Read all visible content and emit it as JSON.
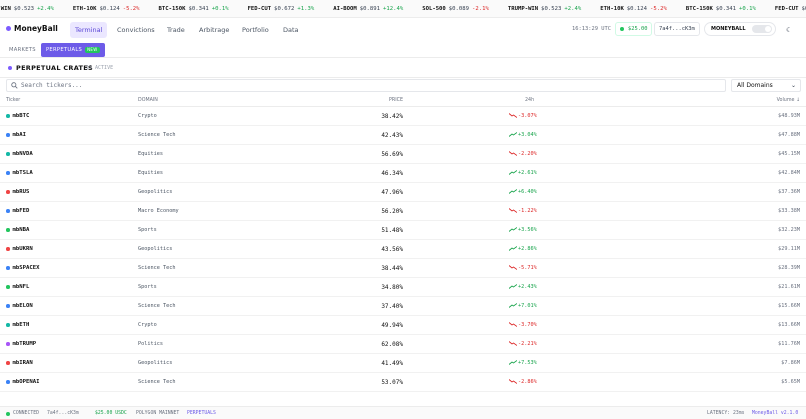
{
  "ticker_items": [
    {
      "sym": "P-WIN",
      "price": "$0.523",
      "chg": "+2.4%",
      "dir": "up"
    },
    {
      "sym": "ETH-10K",
      "price": "$0.124",
      "chg": "-5.2%",
      "dir": "down"
    },
    {
      "sym": "BTC-150K",
      "price": "$0.341",
      "chg": "+0.1%",
      "dir": "up"
    },
    {
      "sym": "FED-CUT",
      "price": "$0.672",
      "chg": "+1.3%",
      "dir": "up"
    },
    {
      "sym": "AI-BOOM",
      "price": "$0.891",
      "chg": "+12.4%",
      "dir": "up"
    },
    {
      "sym": "SOL-500",
      "price": "$0.089",
      "chg": "-2.1%",
      "dir": "down"
    },
    {
      "sym": "TRUMP-WIN",
      "price": "$0.523",
      "chg": "+2.4%",
      "dir": "up"
    },
    {
      "sym": "ETH-10K",
      "price": "$0.124",
      "chg": "-5.2%",
      "dir": "down"
    },
    {
      "sym": "BTC-150K",
      "price": "$0.341",
      "chg": "+0.1%",
      "dir": "up"
    },
    {
      "sym": "FED-CUT",
      "price": "$0.672",
      "chg": "+1.3%",
      "dir": "up"
    }
  ],
  "header": {
    "logo": "MoneyBall",
    "nav": [
      "Terminal",
      "Convictions",
      "Trade",
      "Arbitrage",
      "Portfolio",
      "Data"
    ],
    "clock": "16:13:29 UTC",
    "balance": "$25.00",
    "address": "7a4f...cK3m",
    "toggle_label": "MONEYBALL"
  },
  "subnav": {
    "markets": "MARKETS",
    "perpetuals": "PERPETUALS",
    "new_badge": "NEW"
  },
  "section": {
    "title": "PERPETUAL CRATES",
    "count": "15 ACTIVE"
  },
  "search": {
    "placeholder": "Search tickers...",
    "domain_filter": "All Domains"
  },
  "table": {
    "headers": {
      "ticker": "Ticker",
      "domain": "DOMAIN",
      "price": "PRICE",
      "change": "24h",
      "volume": "Volume ↓"
    },
    "rows": [
      {
        "ticker": "mbBTC",
        "domain": "Crypto",
        "price": "38.42%",
        "change": "-3.07%",
        "dir": "down",
        "volume": "$48.93M",
        "dot": "#14b8a6"
      },
      {
        "ticker": "mbAI",
        "domain": "Science Tech",
        "price": "42.43%",
        "change": "+3.04%",
        "dir": "up",
        "volume": "$47.88M",
        "dot": "#3b82f6"
      },
      {
        "ticker": "mbNVDA",
        "domain": "Equities",
        "price": "56.69%",
        "change": "-2.20%",
        "dir": "down",
        "volume": "$45.15M",
        "dot": "#14b8a6"
      },
      {
        "ticker": "mbTSLA",
        "domain": "Equities",
        "price": "46.34%",
        "change": "+2.61%",
        "dir": "up",
        "volume": "$42.84M",
        "dot": "#3b82f6"
      },
      {
        "ticker": "mbRUS",
        "domain": "Geopolitics",
        "price": "47.96%",
        "change": "+6.40%",
        "dir": "up",
        "volume": "$37.36M",
        "dot": "#ef4444"
      },
      {
        "ticker": "mbFED",
        "domain": "Macro Economy",
        "price": "56.20%",
        "change": "-1.22%",
        "dir": "down",
        "volume": "$33.38M",
        "dot": "#3b82f6"
      },
      {
        "ticker": "mbNBA",
        "domain": "Sports",
        "price": "51.48%",
        "change": "+3.56%",
        "dir": "up",
        "volume": "$32.23M",
        "dot": "#22c55e"
      },
      {
        "ticker": "mbUKRN",
        "domain": "Geopolitics",
        "price": "43.56%",
        "change": "+2.86%",
        "dir": "up",
        "volume": "$29.11M",
        "dot": "#ef4444"
      },
      {
        "ticker": "mbSPACEX",
        "domain": "Science Tech",
        "price": "38.44%",
        "change": "-5.71%",
        "dir": "down",
        "volume": "$28.39M",
        "dot": "#3b82f6"
      },
      {
        "ticker": "mbNFL",
        "domain": "Sports",
        "price": "34.80%",
        "change": "+2.43%",
        "dir": "up",
        "volume": "$21.61M",
        "dot": "#22c55e"
      },
      {
        "ticker": "mbELON",
        "domain": "Science Tech",
        "price": "37.40%",
        "change": "+7.01%",
        "dir": "up",
        "volume": "$15.66M",
        "dot": "#3b82f6"
      },
      {
        "ticker": "mbETH",
        "domain": "Crypto",
        "price": "49.94%",
        "change": "-3.70%",
        "dir": "down",
        "volume": "$13.66M",
        "dot": "#14b8a6"
      },
      {
        "ticker": "mbTRUMP",
        "domain": "Politics",
        "price": "62.08%",
        "change": "-2.21%",
        "dir": "down",
        "volume": "$11.76M",
        "dot": "#a855f7"
      },
      {
        "ticker": "mbIRAN",
        "domain": "Geopolitics",
        "price": "41.49%",
        "change": "+7.53%",
        "dir": "up",
        "volume": "$7.86M",
        "dot": "#ef4444"
      },
      {
        "ticker": "mbOPENAI",
        "domain": "Science Tech",
        "price": "53.07%",
        "change": "-2.86%",
        "dir": "down",
        "volume": "$5.65M",
        "dot": "#3b82f6"
      }
    ]
  },
  "footer": {
    "connected": "CONNECTED",
    "address": "7a4f...cK3m",
    "balance": "$25.00 USDC",
    "network": "POLYGON MAINNET",
    "mode": "PERPETUALS",
    "latency": "LATENCY: 23ms",
    "version": "MoneyBall v2.1.0"
  },
  "colors": {
    "accent": "#6d5be8",
    "up": "#16a34a",
    "down": "#dc2626"
  }
}
